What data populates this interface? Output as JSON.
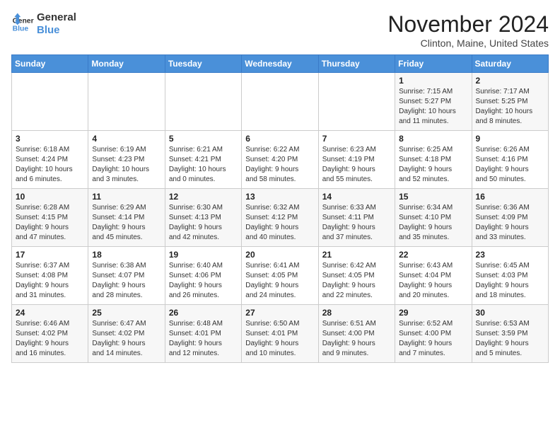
{
  "header": {
    "logo_line1": "General",
    "logo_line2": "Blue",
    "month": "November 2024",
    "location": "Clinton, Maine, United States"
  },
  "weekdays": [
    "Sunday",
    "Monday",
    "Tuesday",
    "Wednesday",
    "Thursday",
    "Friday",
    "Saturday"
  ],
  "weeks": [
    [
      {
        "day": "",
        "info": ""
      },
      {
        "day": "",
        "info": ""
      },
      {
        "day": "",
        "info": ""
      },
      {
        "day": "",
        "info": ""
      },
      {
        "day": "",
        "info": ""
      },
      {
        "day": "1",
        "info": "Sunrise: 7:15 AM\nSunset: 5:27 PM\nDaylight: 10 hours\nand 11 minutes."
      },
      {
        "day": "2",
        "info": "Sunrise: 7:17 AM\nSunset: 5:25 PM\nDaylight: 10 hours\nand 8 minutes."
      }
    ],
    [
      {
        "day": "3",
        "info": "Sunrise: 6:18 AM\nSunset: 4:24 PM\nDaylight: 10 hours\nand 6 minutes."
      },
      {
        "day": "4",
        "info": "Sunrise: 6:19 AM\nSunset: 4:23 PM\nDaylight: 10 hours\nand 3 minutes."
      },
      {
        "day": "5",
        "info": "Sunrise: 6:21 AM\nSunset: 4:21 PM\nDaylight: 10 hours\nand 0 minutes."
      },
      {
        "day": "6",
        "info": "Sunrise: 6:22 AM\nSunset: 4:20 PM\nDaylight: 9 hours\nand 58 minutes."
      },
      {
        "day": "7",
        "info": "Sunrise: 6:23 AM\nSunset: 4:19 PM\nDaylight: 9 hours\nand 55 minutes."
      },
      {
        "day": "8",
        "info": "Sunrise: 6:25 AM\nSunset: 4:18 PM\nDaylight: 9 hours\nand 52 minutes."
      },
      {
        "day": "9",
        "info": "Sunrise: 6:26 AM\nSunset: 4:16 PM\nDaylight: 9 hours\nand 50 minutes."
      }
    ],
    [
      {
        "day": "10",
        "info": "Sunrise: 6:28 AM\nSunset: 4:15 PM\nDaylight: 9 hours\nand 47 minutes."
      },
      {
        "day": "11",
        "info": "Sunrise: 6:29 AM\nSunset: 4:14 PM\nDaylight: 9 hours\nand 45 minutes."
      },
      {
        "day": "12",
        "info": "Sunrise: 6:30 AM\nSunset: 4:13 PM\nDaylight: 9 hours\nand 42 minutes."
      },
      {
        "day": "13",
        "info": "Sunrise: 6:32 AM\nSunset: 4:12 PM\nDaylight: 9 hours\nand 40 minutes."
      },
      {
        "day": "14",
        "info": "Sunrise: 6:33 AM\nSunset: 4:11 PM\nDaylight: 9 hours\nand 37 minutes."
      },
      {
        "day": "15",
        "info": "Sunrise: 6:34 AM\nSunset: 4:10 PM\nDaylight: 9 hours\nand 35 minutes."
      },
      {
        "day": "16",
        "info": "Sunrise: 6:36 AM\nSunset: 4:09 PM\nDaylight: 9 hours\nand 33 minutes."
      }
    ],
    [
      {
        "day": "17",
        "info": "Sunrise: 6:37 AM\nSunset: 4:08 PM\nDaylight: 9 hours\nand 31 minutes."
      },
      {
        "day": "18",
        "info": "Sunrise: 6:38 AM\nSunset: 4:07 PM\nDaylight: 9 hours\nand 28 minutes."
      },
      {
        "day": "19",
        "info": "Sunrise: 6:40 AM\nSunset: 4:06 PM\nDaylight: 9 hours\nand 26 minutes."
      },
      {
        "day": "20",
        "info": "Sunrise: 6:41 AM\nSunset: 4:05 PM\nDaylight: 9 hours\nand 24 minutes."
      },
      {
        "day": "21",
        "info": "Sunrise: 6:42 AM\nSunset: 4:05 PM\nDaylight: 9 hours\nand 22 minutes."
      },
      {
        "day": "22",
        "info": "Sunrise: 6:43 AM\nSunset: 4:04 PM\nDaylight: 9 hours\nand 20 minutes."
      },
      {
        "day": "23",
        "info": "Sunrise: 6:45 AM\nSunset: 4:03 PM\nDaylight: 9 hours\nand 18 minutes."
      }
    ],
    [
      {
        "day": "24",
        "info": "Sunrise: 6:46 AM\nSunset: 4:02 PM\nDaylight: 9 hours\nand 16 minutes."
      },
      {
        "day": "25",
        "info": "Sunrise: 6:47 AM\nSunset: 4:02 PM\nDaylight: 9 hours\nand 14 minutes."
      },
      {
        "day": "26",
        "info": "Sunrise: 6:48 AM\nSunset: 4:01 PM\nDaylight: 9 hours\nand 12 minutes."
      },
      {
        "day": "27",
        "info": "Sunrise: 6:50 AM\nSunset: 4:01 PM\nDaylight: 9 hours\nand 10 minutes."
      },
      {
        "day": "28",
        "info": "Sunrise: 6:51 AM\nSunset: 4:00 PM\nDaylight: 9 hours\nand 9 minutes."
      },
      {
        "day": "29",
        "info": "Sunrise: 6:52 AM\nSunset: 4:00 PM\nDaylight: 9 hours\nand 7 minutes."
      },
      {
        "day": "30",
        "info": "Sunrise: 6:53 AM\nSunset: 3:59 PM\nDaylight: 9 hours\nand 5 minutes."
      }
    ]
  ]
}
